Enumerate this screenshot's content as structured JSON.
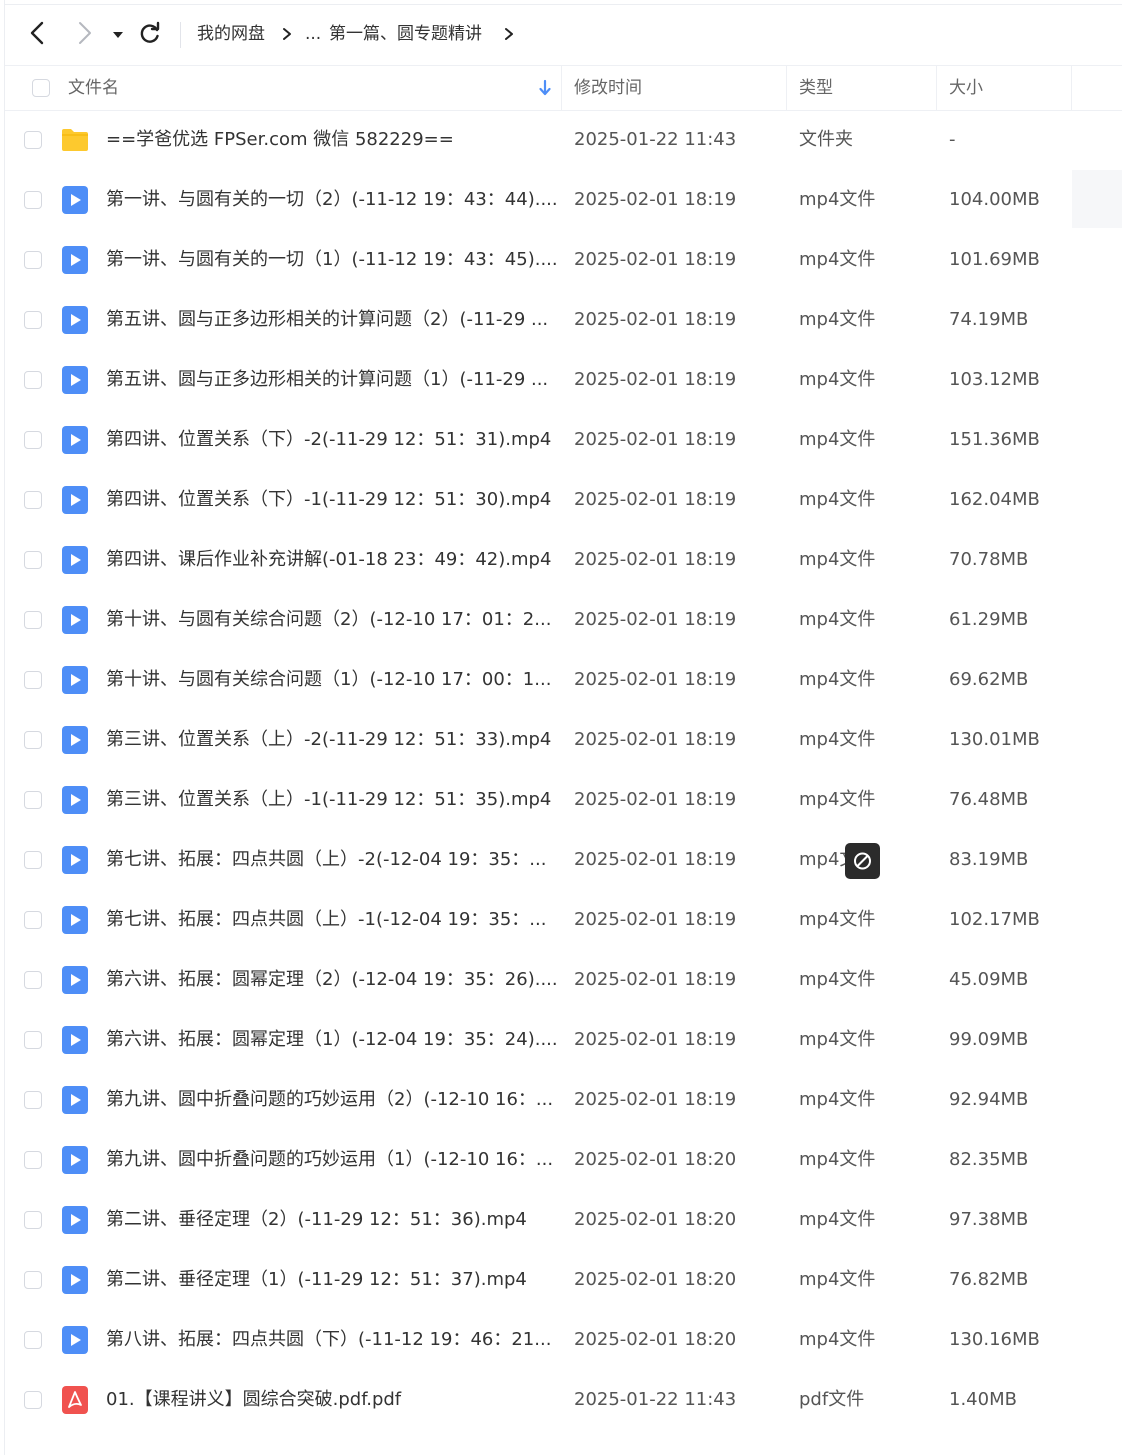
{
  "colors": {
    "accent": "#4e8ef7",
    "folder": "#fdc92e",
    "pdf": "#f0524f",
    "header_text": "#666666"
  },
  "toolbar": {
    "back_icon": "chevron-left-icon",
    "forward_icon": "chevron-right-icon",
    "dropdown_icon": "caret-down-icon",
    "refresh_icon": "refresh-icon",
    "breadcrumb": [
      "我的网盘",
      "...",
      "第一篇、圆专题精讲"
    ]
  },
  "table": {
    "columns": {
      "name": "文件名",
      "modified": "修改时间",
      "type": "类型",
      "size": "大小"
    },
    "rows": [
      {
        "icon": "folder-icon",
        "name": "==学爸优选 FPSer.com 微信 582229==",
        "time": "2025-01-22 11:43",
        "type": "文件夹",
        "size": "-"
      },
      {
        "icon": "video-file-icon",
        "name": "第一讲、与圆有关的一切（2）(-11-12 19：43：44)....",
        "time": "2025-02-01 18:19",
        "type": "mp4文件",
        "size": "104.00MB"
      },
      {
        "icon": "video-file-icon",
        "name": "第一讲、与圆有关的一切（1）(-11-12 19：43：45)....",
        "time": "2025-02-01 18:19",
        "type": "mp4文件",
        "size": "101.69MB"
      },
      {
        "icon": "video-file-icon",
        "name": "第五讲、圆与正多边形相关的计算问题（2）(-11-29 ...",
        "time": "2025-02-01 18:19",
        "type": "mp4文件",
        "size": "74.19MB"
      },
      {
        "icon": "video-file-icon",
        "name": "第五讲、圆与正多边形相关的计算问题（1）(-11-29 ...",
        "time": "2025-02-01 18:19",
        "type": "mp4文件",
        "size": "103.12MB"
      },
      {
        "icon": "video-file-icon",
        "name": "第四讲、位置关系（下）-2(-11-29 12：51：31).mp4",
        "time": "2025-02-01 18:19",
        "type": "mp4文件",
        "size": "151.36MB"
      },
      {
        "icon": "video-file-icon",
        "name": "第四讲、位置关系（下）-1(-11-29 12：51：30).mp4",
        "time": "2025-02-01 18:19",
        "type": "mp4文件",
        "size": "162.04MB"
      },
      {
        "icon": "video-file-icon",
        "name": "第四讲、课后作业补充讲解(-01-18 23：49：42).mp4",
        "time": "2025-02-01 18:19",
        "type": "mp4文件",
        "size": "70.78MB"
      },
      {
        "icon": "video-file-icon",
        "name": "第十讲、与圆有关综合问题（2）(-12-10 17：01：2...",
        "time": "2025-02-01 18:19",
        "type": "mp4文件",
        "size": "61.29MB"
      },
      {
        "icon": "video-file-icon",
        "name": "第十讲、与圆有关综合问题（1）(-12-10 17：00：1...",
        "time": "2025-02-01 18:19",
        "type": "mp4文件",
        "size": "69.62MB"
      },
      {
        "icon": "video-file-icon",
        "name": "第三讲、位置关系（上）-2(-11-29 12：51：33).mp4",
        "time": "2025-02-01 18:19",
        "type": "mp4文件",
        "size": "130.01MB"
      },
      {
        "icon": "video-file-icon",
        "name": "第三讲、位置关系（上）-1(-11-29 12：51：35).mp4",
        "time": "2025-02-01 18:19",
        "type": "mp4文件",
        "size": "76.48MB"
      },
      {
        "icon": "video-file-icon",
        "name": "第七讲、拓展：四点共圆（上）-2(-12-04 19：35：...",
        "time": "2025-02-01 18:19",
        "type": "mp4文件",
        "size": "83.19MB"
      },
      {
        "icon": "video-file-icon",
        "name": "第七讲、拓展：四点共圆（上）-1(-12-04 19：35：...",
        "time": "2025-02-01 18:19",
        "type": "mp4文件",
        "size": "102.17MB"
      },
      {
        "icon": "video-file-icon",
        "name": "第六讲、拓展：圆幂定理（2）(-12-04 19：35：26)....",
        "time": "2025-02-01 18:19",
        "type": "mp4文件",
        "size": "45.09MB"
      },
      {
        "icon": "video-file-icon",
        "name": "第六讲、拓展：圆幂定理（1）(-12-04 19：35：24)....",
        "time": "2025-02-01 18:19",
        "type": "mp4文件",
        "size": "99.09MB"
      },
      {
        "icon": "video-file-icon",
        "name": "第九讲、圆中折叠问题的巧妙运用（2）(-12-10 16：...",
        "time": "2025-02-01 18:19",
        "type": "mp4文件",
        "size": "92.94MB"
      },
      {
        "icon": "video-file-icon",
        "name": "第九讲、圆中折叠问题的巧妙运用（1）(-12-10 16：...",
        "time": "2025-02-01 18:20",
        "type": "mp4文件",
        "size": "82.35MB"
      },
      {
        "icon": "video-file-icon",
        "name": "第二讲、垂径定理（2）(-11-29 12：51：36).mp4",
        "time": "2025-02-01 18:20",
        "type": "mp4文件",
        "size": "97.38MB"
      },
      {
        "icon": "video-file-icon",
        "name": "第二讲、垂径定理（1）(-11-29 12：51：37).mp4",
        "time": "2025-02-01 18:20",
        "type": "mp4文件",
        "size": "76.82MB"
      },
      {
        "icon": "video-file-icon",
        "name": "第八讲、拓展：四点共圆（下）(-11-12 19：46：21...",
        "time": "2025-02-01 18:20",
        "type": "mp4文件",
        "size": "130.16MB"
      },
      {
        "icon": "pdf-file-icon",
        "name": "01.【课程讲义】圆综合突破.pdf.pdf",
        "time": "2025-01-22 11:43",
        "type": "pdf文件",
        "size": "1.40MB"
      }
    ]
  },
  "overlay": {
    "icon": "prohibited-icon"
  }
}
